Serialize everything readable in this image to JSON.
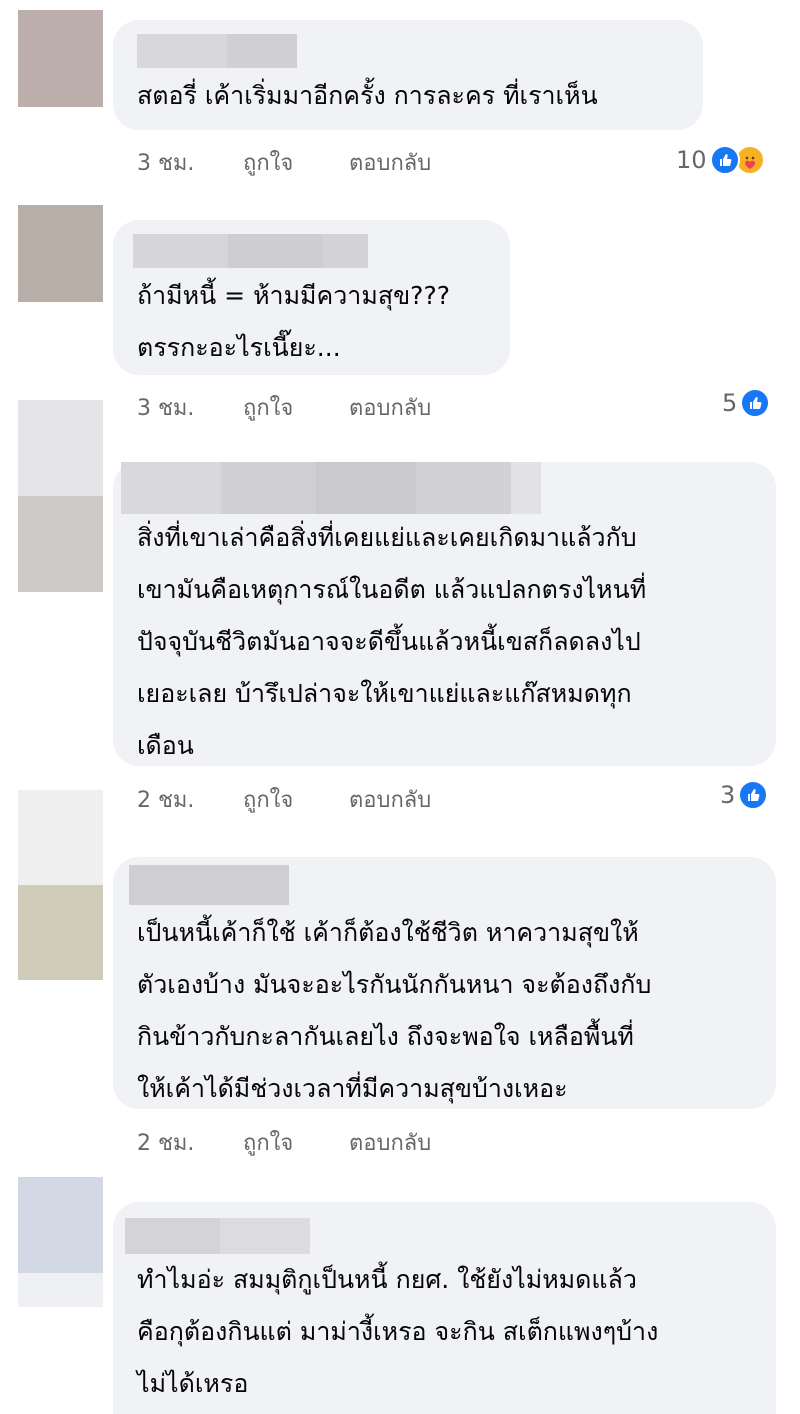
{
  "colors": {
    "bubble": "#f0f2f5",
    "text": "#050505",
    "meta": "#65676b",
    "like_blue": "#1877f2",
    "care_yellow": "#f7b125"
  },
  "actions": {
    "like_label": "ถูกใจ",
    "reply_label": "ตอบกลับ"
  },
  "comments": [
    {
      "text": "สตอรี่ เค้าเริ่มมาอีกครั้ง  การละคร ที่เราเห็น",
      "time": "3 ชม.",
      "reaction_count": "10",
      "reactions": [
        "like-icon",
        "care-icon"
      ]
    },
    {
      "text": "ถ้ามีหนี้ = ห้ามมีความสุข???\nตรรกะอะไรเนี๊ยะ...",
      "time": "3 ชม.",
      "reaction_count": "5",
      "reactions": [
        "like-icon"
      ]
    },
    {
      "text": "สิ่งที่เขาเล่าคือสิ่งที่เคยแย่และเคยเกิดมาแล้วกับ\nเขามันคือเหตุการณ์ในอดีต แล้วแปลกตรงไหนที่\nปัจจุบันชีวิตมันอาจจะดีขึ้นแล้วหนี้เขสก็ลดลงไป\nเยอะเลย บ้ารึเปล่าจะให้เขาแย่และแก๊สหมดทุก\nเดือน",
      "time": "2 ชม.",
      "reaction_count": "3",
      "reactions": [
        "like-icon"
      ]
    },
    {
      "text": "เป็นหนี้เค้าก็ใช้ เค้าก็ต้องใช้ชีวิต หาความสุขให้\nตัวเองบ้าง มันจะอะไรกันนักกันหนา จะต้องถึงกับ\nกินข้าวกับกะลากันเลยไง ถึงจะพอใจ เหลือพื้นที่\nให้เค้าได้มีช่วงเวลาที่มีความสุขบ้างเหอะ",
      "time": "2 ชม.",
      "reaction_count": "",
      "reactions": []
    },
    {
      "text": "ทำไมอ่ะ สมมุติกูเป็นหนี้ กยศ. ใช้ยังไม่หมดแล้ว\nคือกุต้องกินแต่ มาม่างี้เหรอ จะกิน สเต็กแพงๆบ้าง\nไม่ได้เหรอ",
      "time": "",
      "reaction_count": "",
      "reactions": []
    }
  ]
}
